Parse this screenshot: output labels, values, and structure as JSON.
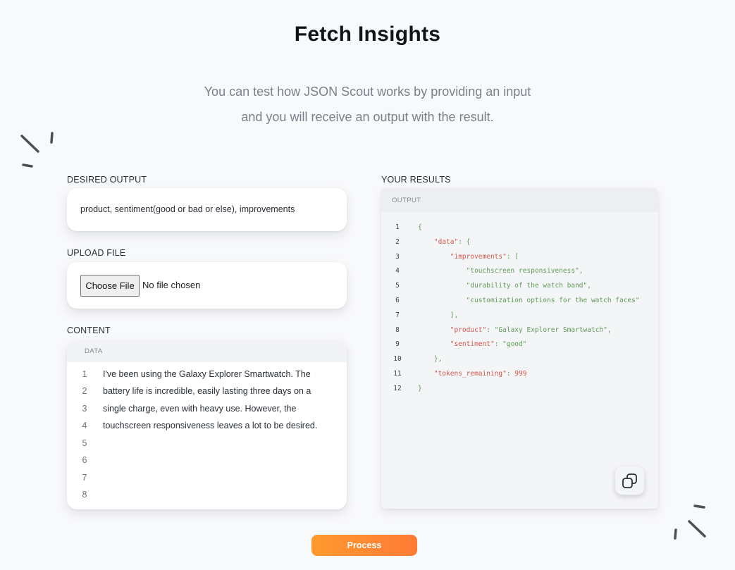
{
  "header": {
    "title": "Fetch Insights",
    "subtitle_line1": "You can test how JSON Scout works by providing an input",
    "subtitle_line2": "and you will receive an output with the result."
  },
  "desired_output": {
    "label": "DESIRED OUTPUT",
    "value": "product, sentiment(good or bad or else), improvements"
  },
  "upload_file": {
    "label": "UPLOAD FILE",
    "button_label": "Choose File",
    "status": "No file chosen"
  },
  "content": {
    "label": "CONTENT",
    "header": "DATA",
    "lines": [
      {
        "num": "1",
        "text": "I've been using the Galaxy Explorer Smartwatch. The"
      },
      {
        "num": "2",
        "text": "battery life is incredible, easily lasting three days on a"
      },
      {
        "num": "3",
        "text": "single charge, even with heavy use. However, the"
      },
      {
        "num": "4",
        "text": "touchscreen responsiveness leaves a lot to be desired."
      },
      {
        "num": "5",
        "text": ""
      },
      {
        "num": "6",
        "text": ""
      },
      {
        "num": "7",
        "text": ""
      },
      {
        "num": "8",
        "text": ""
      }
    ]
  },
  "results": {
    "label": "YOUR RESULTS",
    "header": "OUTPUT",
    "lines": [
      {
        "num": "1",
        "parts": [
          {
            "t": "{",
            "c": "p"
          }
        ]
      },
      {
        "num": "2",
        "parts": [
          {
            "t": "    ",
            "c": "p"
          },
          {
            "t": "\"data\"",
            "c": "k"
          },
          {
            "t": ": {",
            "c": "p"
          }
        ]
      },
      {
        "num": "3",
        "parts": [
          {
            "t": "        ",
            "c": "p"
          },
          {
            "t": "\"improvements\"",
            "c": "k"
          },
          {
            "t": ": [",
            "c": "p"
          }
        ]
      },
      {
        "num": "4",
        "parts": [
          {
            "t": "            ",
            "c": "p"
          },
          {
            "t": "\"touchscreen responsiveness\"",
            "c": "s"
          },
          {
            "t": ",",
            "c": "p"
          }
        ]
      },
      {
        "num": "5",
        "parts": [
          {
            "t": "            ",
            "c": "p"
          },
          {
            "t": "\"durability of the watch band\"",
            "c": "s"
          },
          {
            "t": ",",
            "c": "p"
          }
        ]
      },
      {
        "num": "6",
        "parts": [
          {
            "t": "            ",
            "c": "p"
          },
          {
            "t": "\"customization options for the watch faces\"",
            "c": "s"
          }
        ]
      },
      {
        "num": "7",
        "parts": [
          {
            "t": "        ],",
            "c": "p"
          }
        ]
      },
      {
        "num": "8",
        "parts": [
          {
            "t": "        ",
            "c": "p"
          },
          {
            "t": "\"product\"",
            "c": "k"
          },
          {
            "t": ": ",
            "c": "p"
          },
          {
            "t": "\"Galaxy Explorer Smartwatch\"",
            "c": "s"
          },
          {
            "t": ",",
            "c": "p"
          }
        ]
      },
      {
        "num": "9",
        "parts": [
          {
            "t": "        ",
            "c": "p"
          },
          {
            "t": "\"sentiment\"",
            "c": "k"
          },
          {
            "t": ": ",
            "c": "p"
          },
          {
            "t": "\"good\"",
            "c": "s"
          }
        ]
      },
      {
        "num": "10",
        "parts": [
          {
            "t": "    },",
            "c": "p"
          }
        ]
      },
      {
        "num": "11",
        "parts": [
          {
            "t": "    ",
            "c": "p"
          },
          {
            "t": "\"tokens_remaining\"",
            "c": "k"
          },
          {
            "t": ": ",
            "c": "p"
          },
          {
            "t": "999",
            "c": "n"
          }
        ]
      },
      {
        "num": "12",
        "parts": [
          {
            "t": "}",
            "c": "p"
          }
        ]
      }
    ],
    "copy_icon": "copy-icon"
  },
  "actions": {
    "process_label": "Process"
  },
  "colors": {
    "accent_start": "#ff9a2e",
    "accent_end": "#ff7a35",
    "json_key": "#d0574a",
    "json_string": "#5f9b57",
    "background": "#f8f9fb"
  }
}
